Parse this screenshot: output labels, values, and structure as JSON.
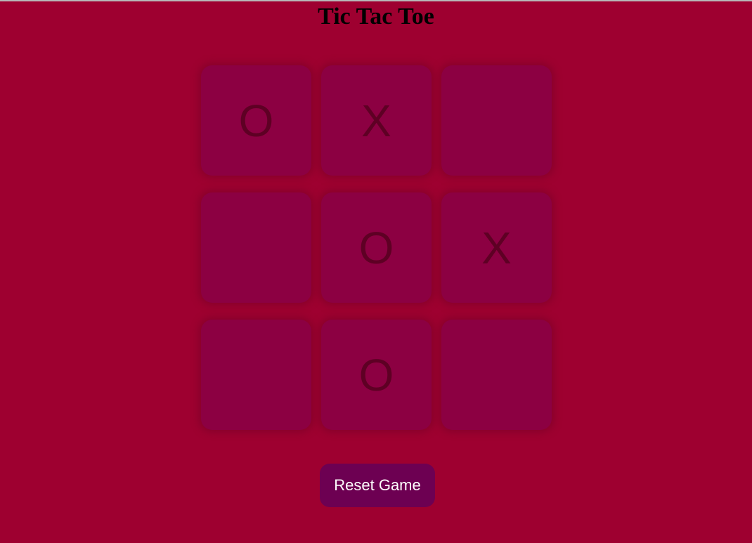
{
  "title": "Tic Tac Toe",
  "board": {
    "cells": [
      "O",
      "X",
      "",
      "",
      "O",
      "X",
      "",
      "O",
      ""
    ]
  },
  "reset_button": {
    "label": "Reset Game"
  },
  "colors": {
    "background": "#9e0030",
    "cell": "#8c0042",
    "mark": "#5e0024",
    "button": "#6d0052",
    "button_text": "#ffffff"
  }
}
